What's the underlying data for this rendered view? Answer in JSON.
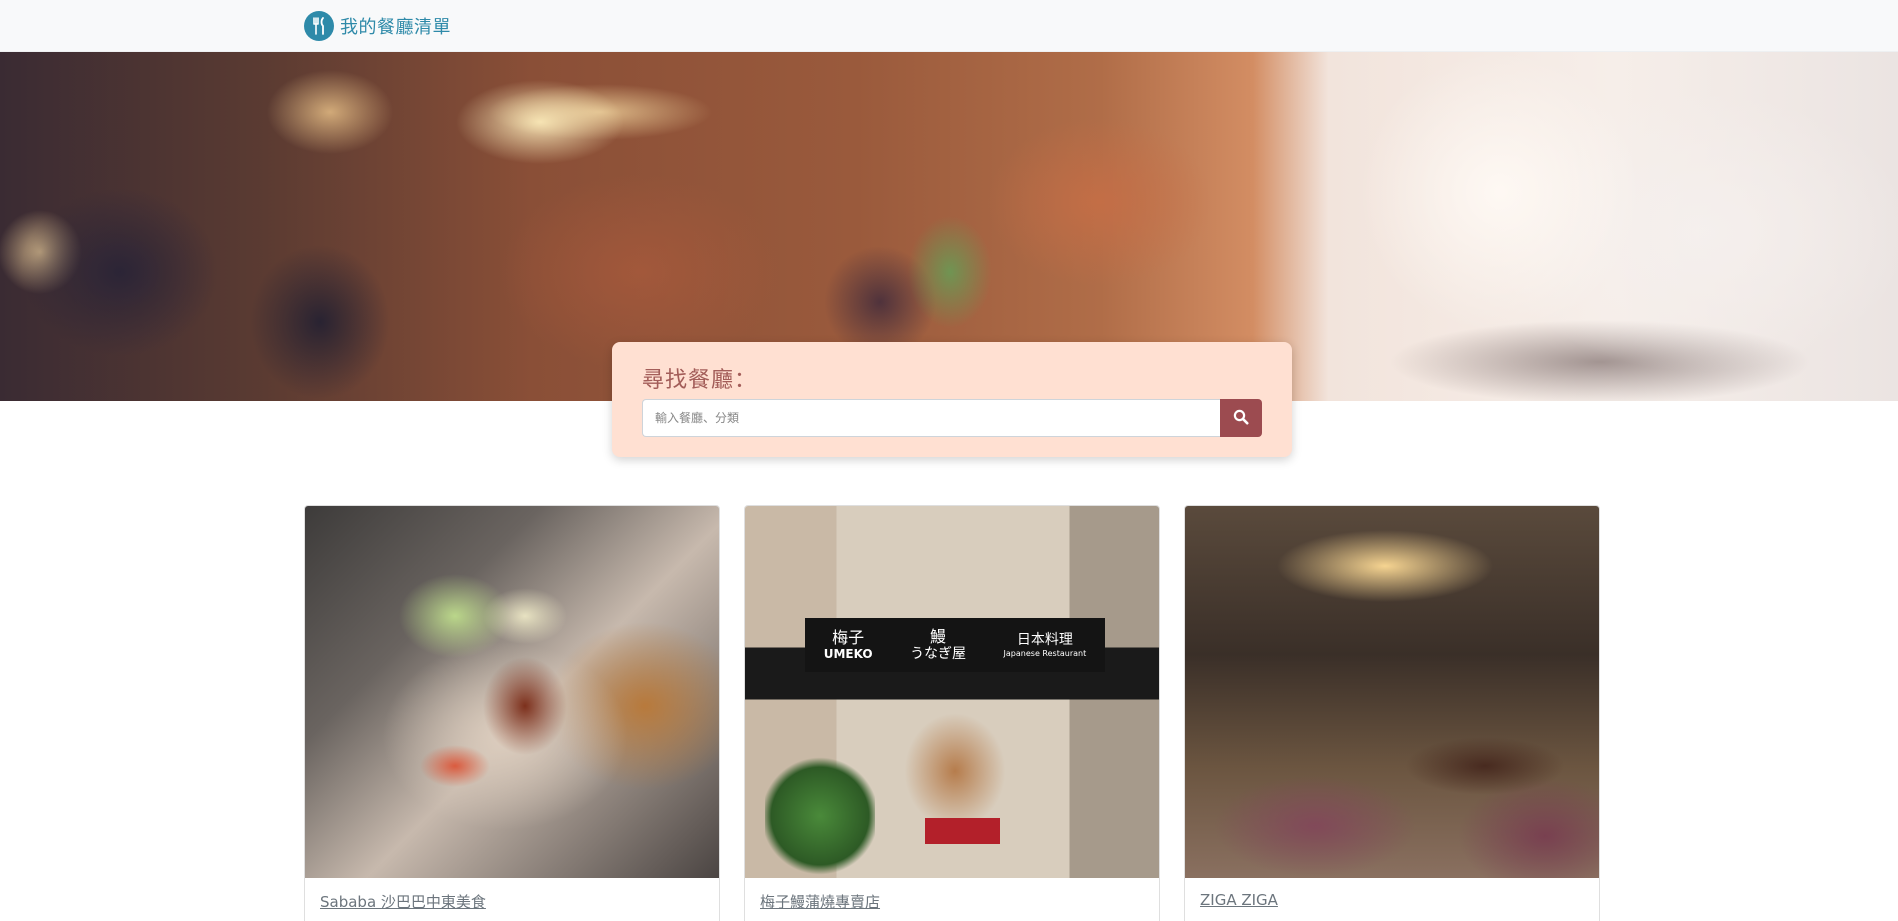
{
  "navbar": {
    "brand_icon": "utensils-icon",
    "brand_title": "我的餐廳清單"
  },
  "search": {
    "title": "尋找餐廳：",
    "placeholder": "輸入餐廳、分類",
    "button_icon": "search-icon"
  },
  "restaurants": [
    {
      "name": "Sababa 沙巴巴中東美食"
    },
    {
      "name": "梅子鰻蒲燒專賣店"
    },
    {
      "name": "ZIGA ZIGA"
    }
  ],
  "storefront_sign": {
    "left": "梅子",
    "left_sub": "UMEKO",
    "middle": "鰻",
    "middle_sub": "うなぎ屋",
    "right": "日本料理",
    "right_sub": "Japanese Restaurant"
  },
  "colors": {
    "brand": "#2e8aa9",
    "navbar_bg": "#f8f9fa",
    "search_bg": "#ffe0d2",
    "search_title": "#a35d59",
    "search_button": "#9c4b50"
  }
}
